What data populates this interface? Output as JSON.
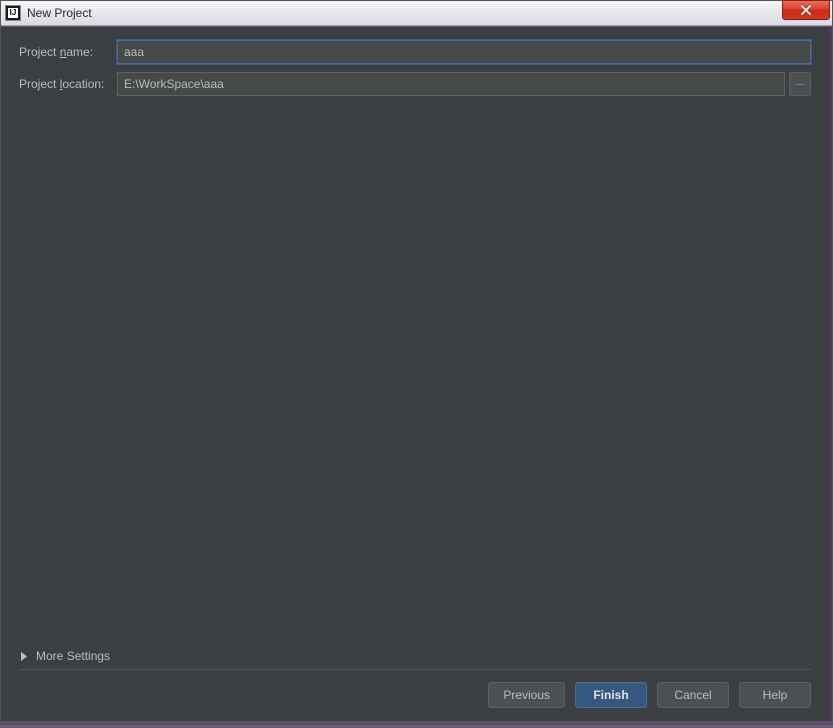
{
  "window": {
    "title": "New Project"
  },
  "form": {
    "name_label_pre": "Project ",
    "name_label_mn": "n",
    "name_label_post": "ame:",
    "name_value": "aaa",
    "location_label_pre": "Project ",
    "location_label_mn": "l",
    "location_label_post": "ocation:",
    "location_value": "E:\\WorkSpace\\aaa",
    "browse_label": "..."
  },
  "more_settings": {
    "label_pre": "Mor",
    "label_mn": "e",
    "label_post": " Settings"
  },
  "buttons": {
    "previous": "Previous",
    "finish": "Finish",
    "cancel": "Cancel",
    "help": "Help"
  }
}
